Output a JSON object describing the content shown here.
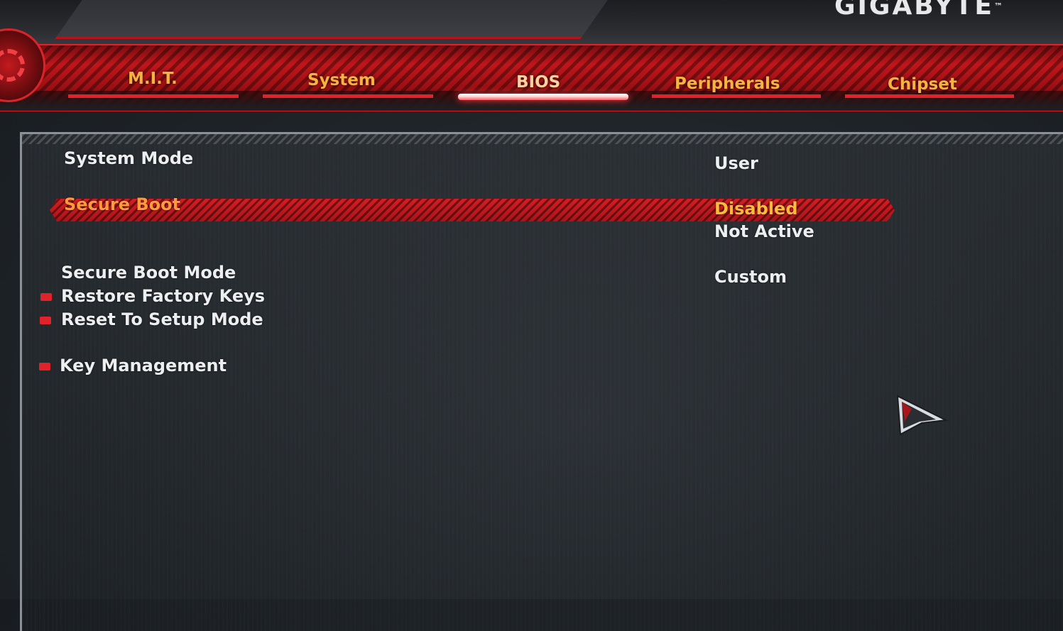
{
  "brand": {
    "logo_text": "GIGABYTE",
    "logo_mark": "™"
  },
  "tabs": [
    {
      "label": "M.I.T.",
      "active": false
    },
    {
      "label": "System",
      "active": false
    },
    {
      "label": "BIOS",
      "active": true
    },
    {
      "label": "Peripherals",
      "active": false
    },
    {
      "label": "Chipset",
      "active": false
    }
  ],
  "settings": {
    "system_mode": {
      "label": "System Mode",
      "value": "User"
    },
    "secure_boot": {
      "label": "Secure Boot",
      "value": "Disabled",
      "status": "Not Active",
      "selected": true
    },
    "secure_boot_mode": {
      "label": "Secure Boot Mode",
      "value": "Custom"
    },
    "restore_factory_keys": {
      "label": "Restore Factory Keys"
    },
    "reset_to_setup_mode": {
      "label": "Reset To Setup Mode"
    },
    "key_management": {
      "label": "Key Management"
    }
  },
  "colors": {
    "accent_red": "#d41c22",
    "tab_text": "#f5b341",
    "selected_text": "#ffb93c",
    "item_text": "#eceef0"
  },
  "icons": {
    "gear": "gear-icon",
    "submenu_marker": "submenu-marker-icon",
    "pointer": "mouse-pointer-icon"
  }
}
